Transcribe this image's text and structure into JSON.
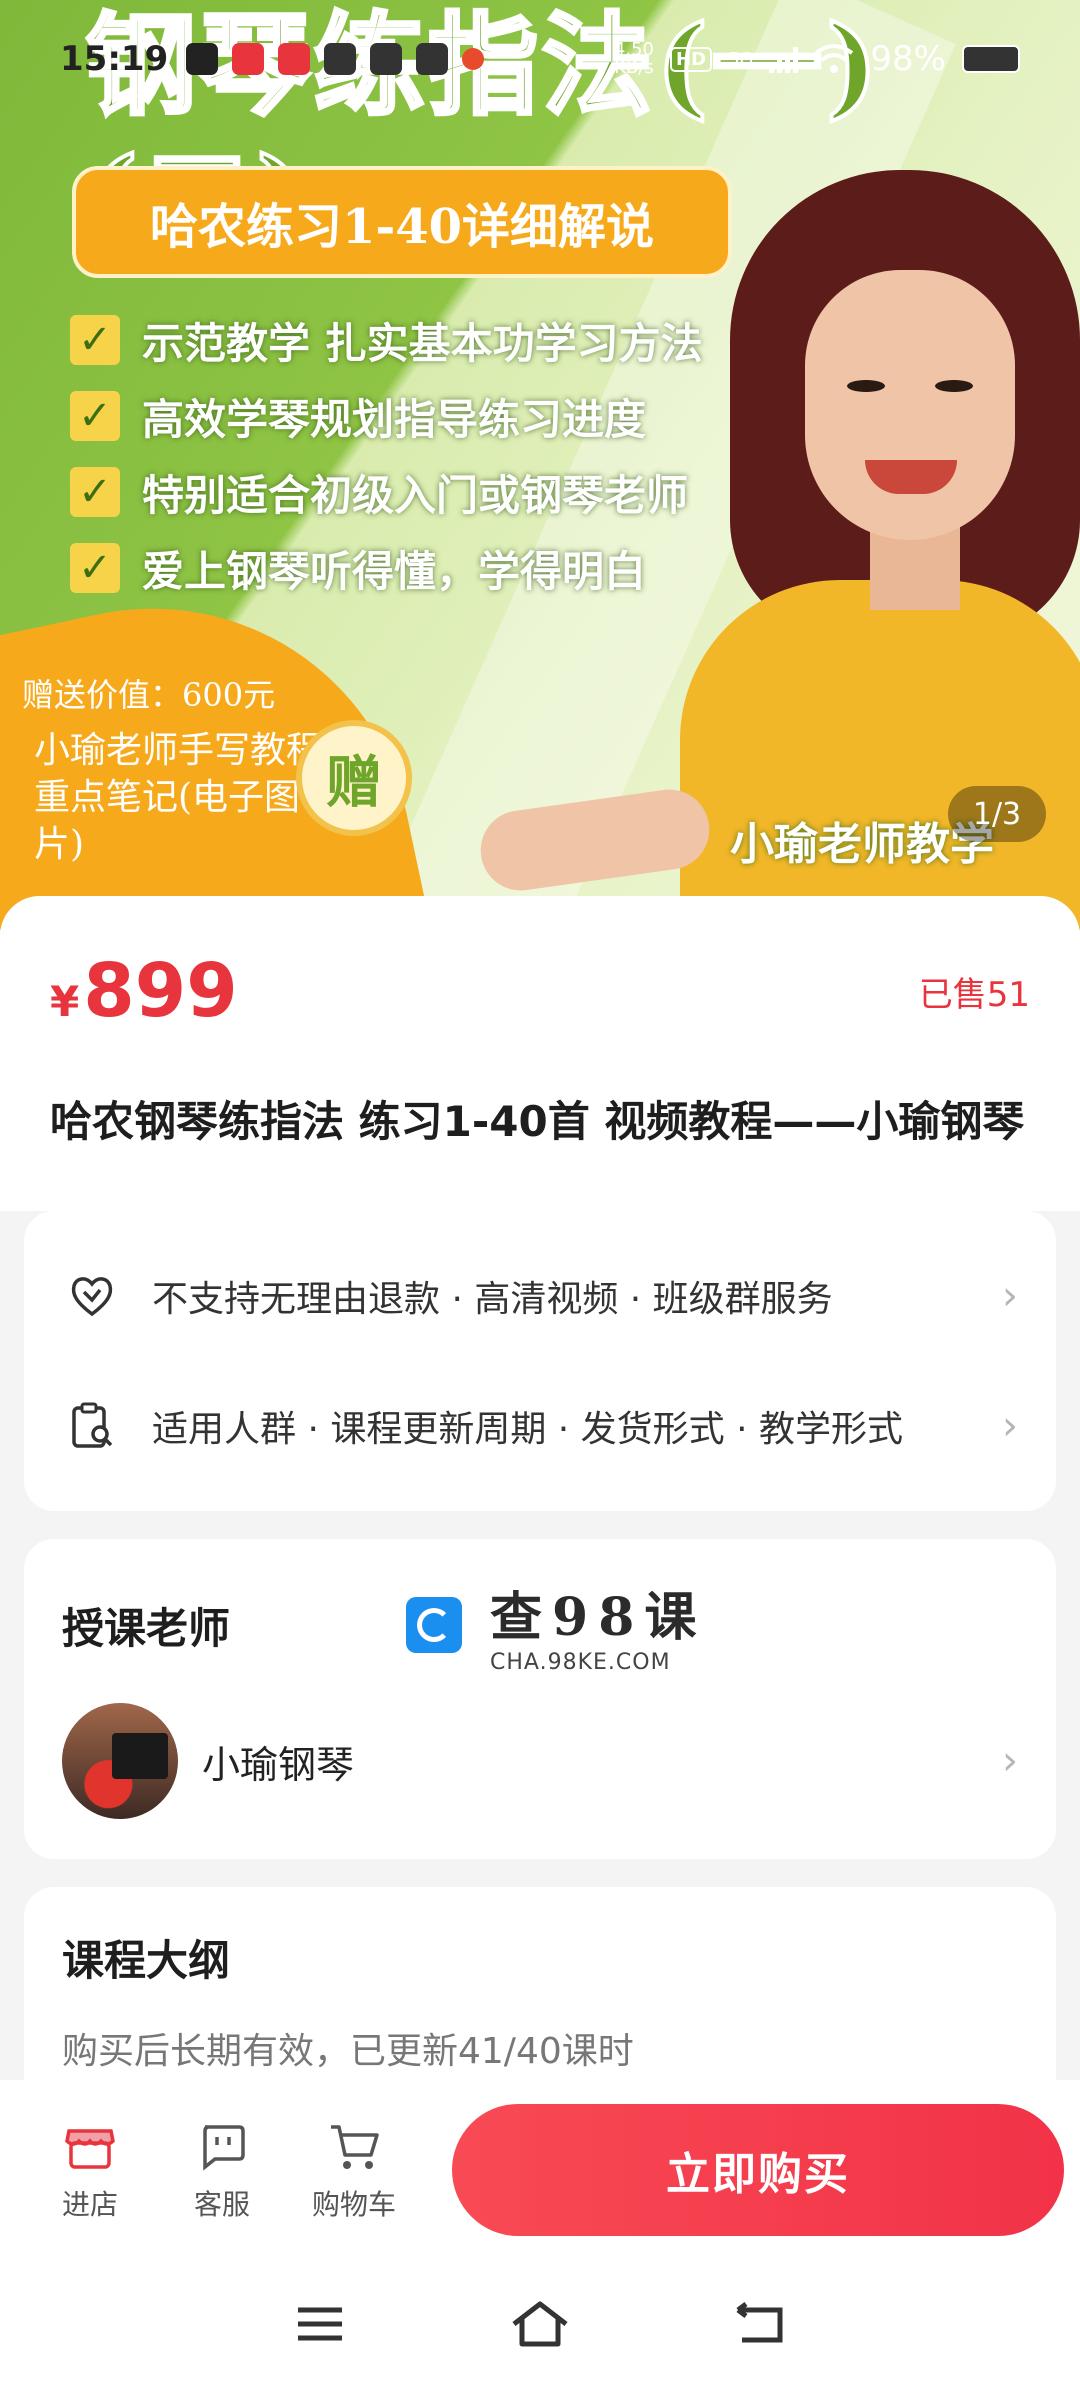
{
  "status_bar": {
    "time": "15:19",
    "net_speed_value": "4.50",
    "net_speed_unit": "KB/s",
    "hd_label": "HD",
    "network": "5G",
    "battery": "98%"
  },
  "banner": {
    "title": "钢琴练指法(一)(二)",
    "subtitle": "哈农练习1-40详细解说",
    "features": [
      "示范教学 扎实基本功学习方法",
      "高效学琴规划指导练习进度",
      "特别适合初级入门或钢琴老师",
      "爱上钢琴听得懂，学得明白"
    ],
    "gift_value": "赠送价值：600元",
    "gift_desc": "小瑜老师手写教程重点笔记(电子图片)",
    "gift_badge": "赠",
    "teacher_caption": "小瑜老师教学",
    "page_indicator": "1/3",
    "accent": "#7fb83a",
    "gift_color": "#f7a91c"
  },
  "product": {
    "currency": "¥",
    "price": "899",
    "sold": "已售51",
    "title": "哈农钢琴练指法 练习1-40首 视频教程——小瑜钢琴",
    "price_color": "#e8343d"
  },
  "services": {
    "row1": "不支持无理由退款 · 高清视频 · 班级群服务",
    "row2": "适用人群 · 课程更新周期 · 发货形式 · 教学形式"
  },
  "teacher": {
    "heading": "授课老师",
    "name": "小瑜钢琴",
    "watermark_big": "查98课",
    "watermark_small": "CHA.98KE.COM"
  },
  "outline": {
    "heading": "课程大纲",
    "desc": "购买后长期有效，已更新41/40课时"
  },
  "action_bar": {
    "store": "进店",
    "service": "客服",
    "cart": "购物车",
    "buy": "立即购买",
    "buy_color": "#f23248"
  }
}
